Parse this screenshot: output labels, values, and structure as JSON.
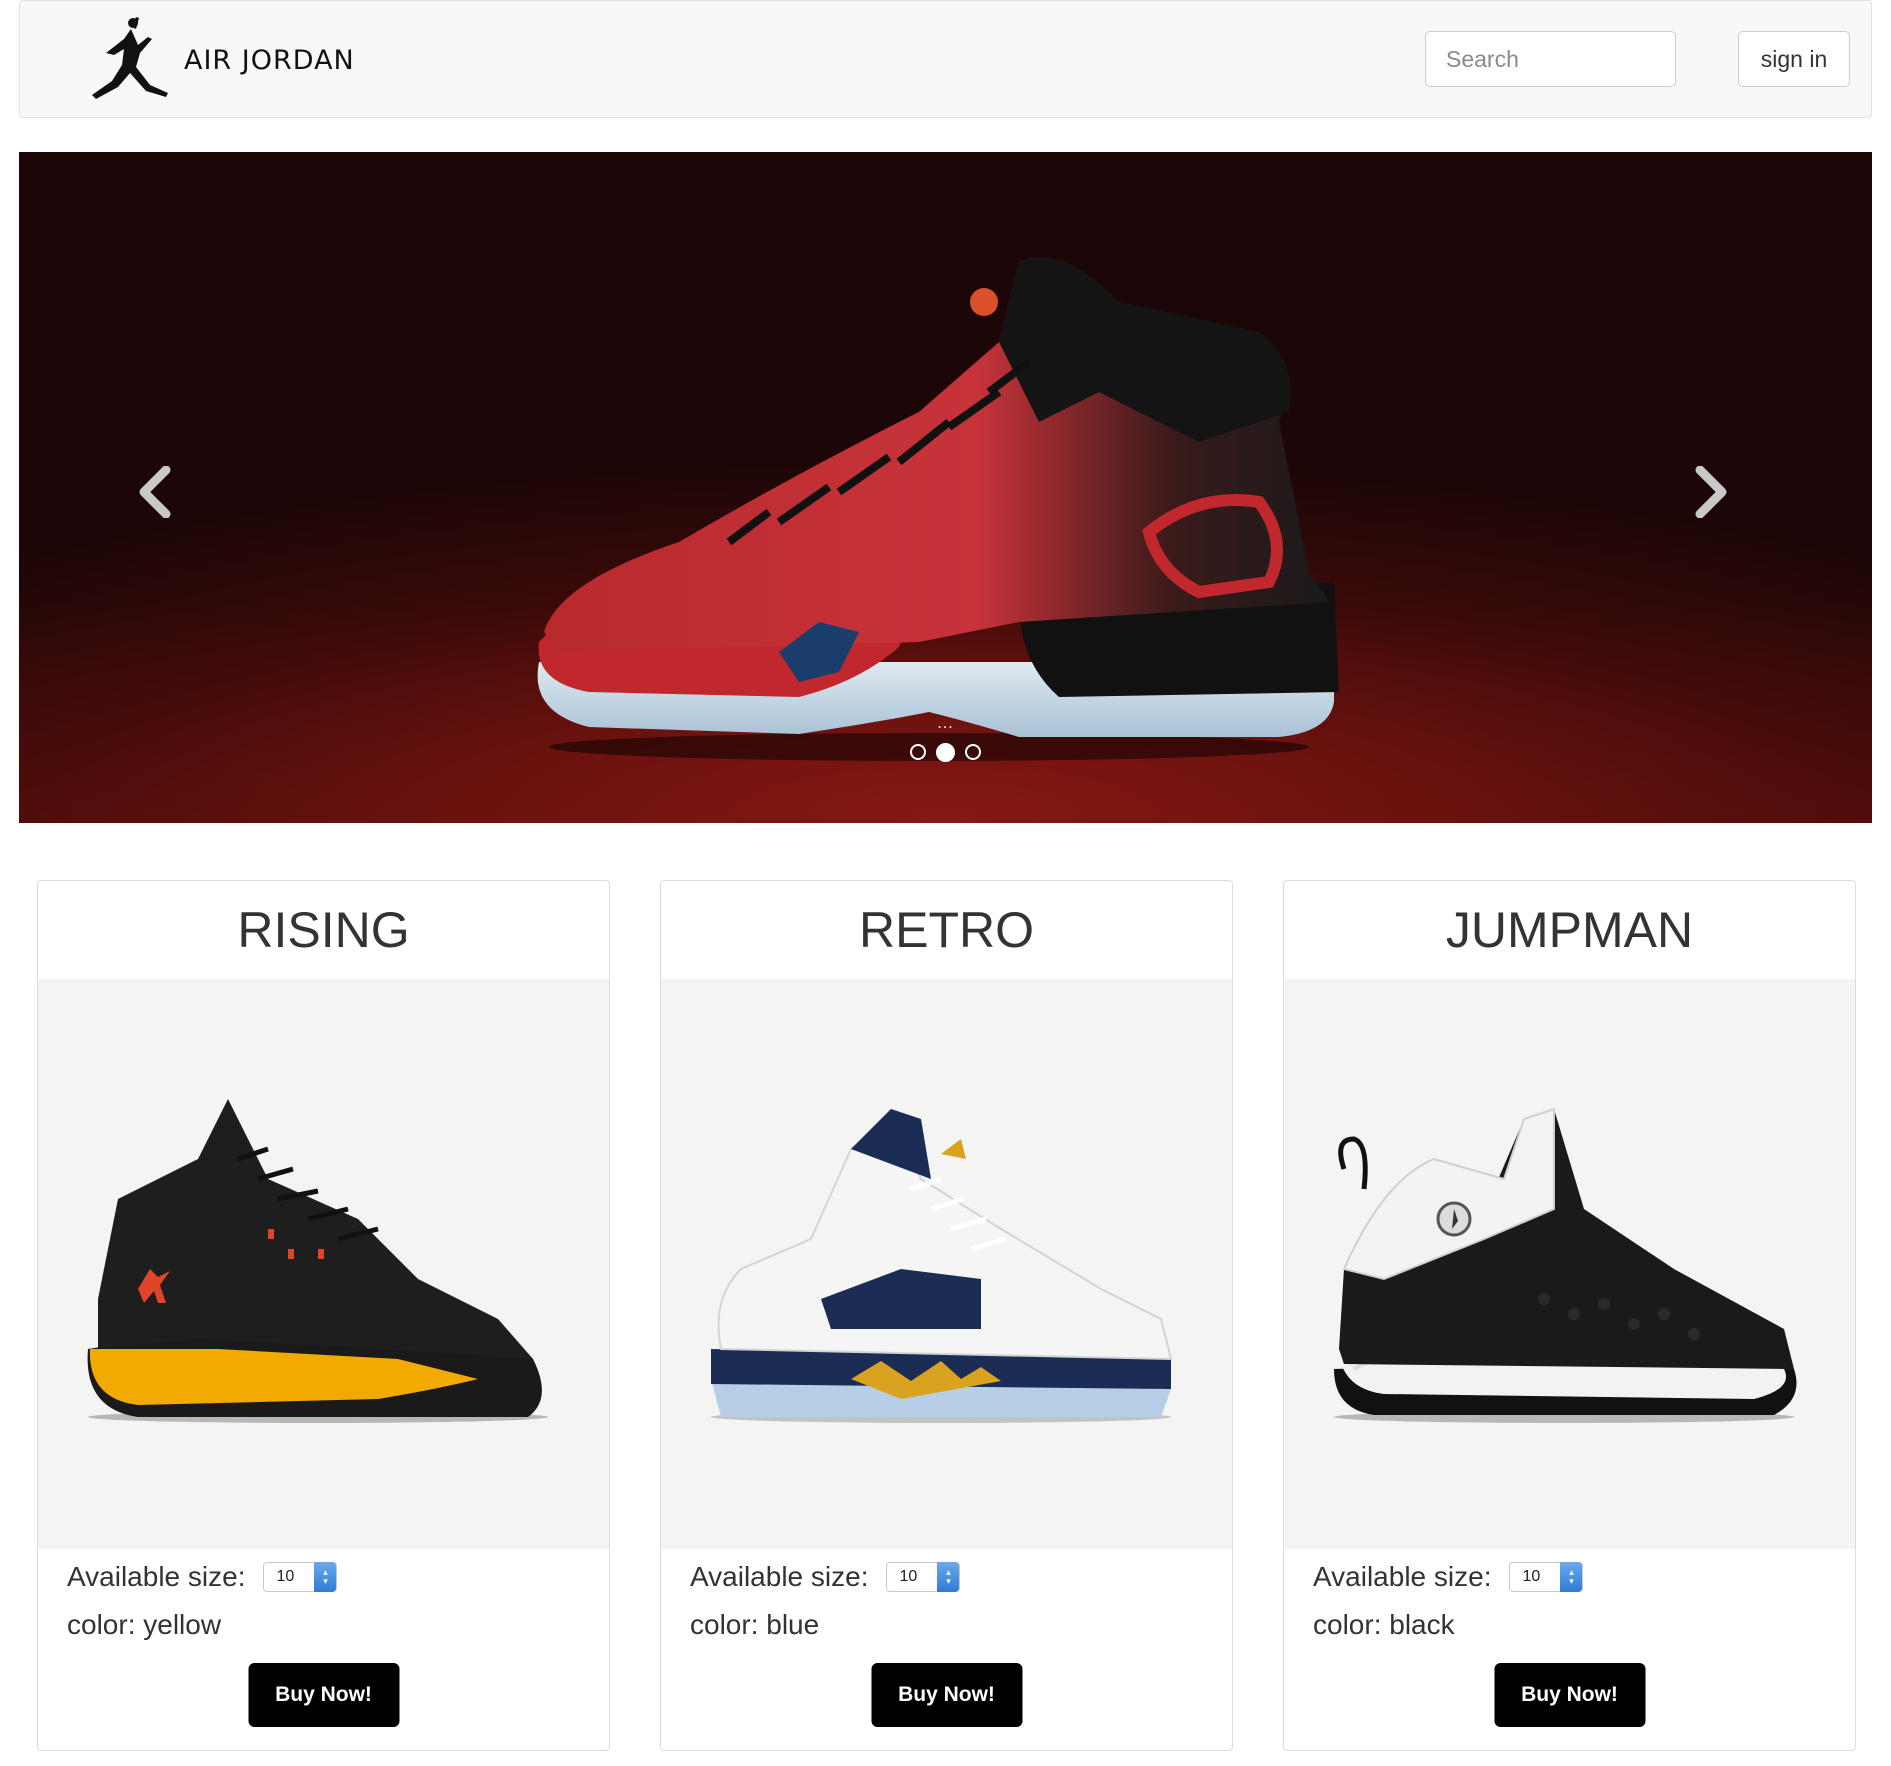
{
  "navbar": {
    "brand_text": "AIR JORDAN",
    "search_placeholder": "Search",
    "signin_label": "sign in"
  },
  "carousel": {
    "prev_icon": "chevron-left-icon",
    "next_icon": "chevron-right-icon",
    "caption_dots": "...",
    "slide_count": 3,
    "active_index": 1,
    "background_color": "#6a120f"
  },
  "products": [
    {
      "title": "RISING",
      "size_label": "Available size:",
      "size_value": "10",
      "color_text": "color: yellow",
      "button_label": "Buy Now!",
      "accent": "#f2a900"
    },
    {
      "title": "RETRO",
      "size_label": "Available size:",
      "size_value": "10",
      "color_text": "color: blue",
      "button_label": "Buy Now!",
      "accent": "#1c2d55"
    },
    {
      "title": "JUMPMAN",
      "size_label": "Available size:",
      "size_value": "10",
      "color_text": "color: black",
      "button_label": "Buy Now!",
      "accent": "#111111"
    }
  ]
}
